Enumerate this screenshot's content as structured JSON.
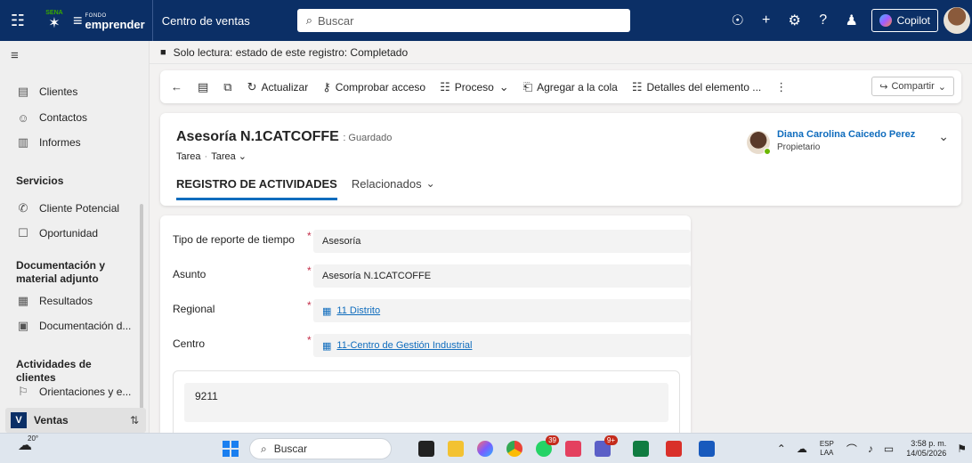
{
  "topbar": {
    "logo_sena": "SENA",
    "logo_fondo_top": "FONDO",
    "logo_fondo_main": "emprender",
    "app_name": "Centro de ventas",
    "search_placeholder": "Buscar",
    "copilot_label": "Copilot",
    "icons": [
      "waffle-icon",
      "lightbulb-icon",
      "plus-icon",
      "gear-icon",
      "help-icon",
      "people-icon"
    ]
  },
  "sidebar": {
    "items": [
      {
        "label": "Clientes",
        "icon": "building-icon"
      },
      {
        "label": "Contactos",
        "icon": "person-icon"
      },
      {
        "label": "Informes",
        "icon": "report-icon"
      }
    ],
    "sections": [
      {
        "title": "Servicios",
        "items": [
          {
            "label": "Cliente Potencial",
            "icon": "phone-person-icon"
          },
          {
            "label": "Oportunidad",
            "icon": "opportunity-icon"
          }
        ]
      },
      {
        "title": "Documentación y material adjunto",
        "items": [
          {
            "label": "Resultados",
            "icon": "document-icon"
          },
          {
            "label": "Documentación d...",
            "icon": "attachment-icon"
          }
        ]
      },
      {
        "title": "Actividades de clientes",
        "items": [
          {
            "label": "Orientaciones y e...",
            "icon": "flag-icon"
          }
        ]
      }
    ],
    "area": {
      "badge": "V",
      "label": "Ventas"
    }
  },
  "banner": {
    "text": "Solo lectura: estado de este registro: Completado"
  },
  "commandbar": {
    "refresh": "Actualizar",
    "check_access": "Comprobar acceso",
    "process": "Proceso",
    "add_queue": "Agregar a la cola",
    "item_details": "Detalles del elemento ...",
    "share": "Compartir"
  },
  "record": {
    "title": "Asesoría N.1CATCOFFE",
    "status": ": Guardado",
    "entity": "Tarea",
    "form": "Tarea",
    "owner_name": "Diana Carolina Caicedo Perez",
    "owner_role": "Propietario",
    "tabs": [
      {
        "label": "REGISTRO DE ACTIVIDADES",
        "active": true
      },
      {
        "label": "Relacionados",
        "active": false
      }
    ]
  },
  "form": {
    "fields": [
      {
        "label": "Tipo de reporte de tiempo",
        "value": "Asesoría",
        "lookup": false
      },
      {
        "label": "Asunto",
        "value": "Asesoría N.1CATCOFFE",
        "lookup": false
      },
      {
        "label": "Regional",
        "value": "11 Distrito",
        "lookup": true
      },
      {
        "label": "Centro",
        "value": "11-Centro de Gestión Industrial",
        "lookup": true
      }
    ],
    "required_mark": "*",
    "description_value": "9211"
  },
  "taskbar": {
    "weather_temp": "20°",
    "search_placeholder": "Buscar",
    "whatsapp_badge": "39",
    "teams_badge": "9+",
    "lang_top": "ESP",
    "lang_bottom": "LAA",
    "time": "3:58 p. m.",
    "date": "14/05/2026"
  },
  "colors": {
    "header_bg": "#0b2f66",
    "accent": "#0f6cbd",
    "required": "#c4314b"
  }
}
